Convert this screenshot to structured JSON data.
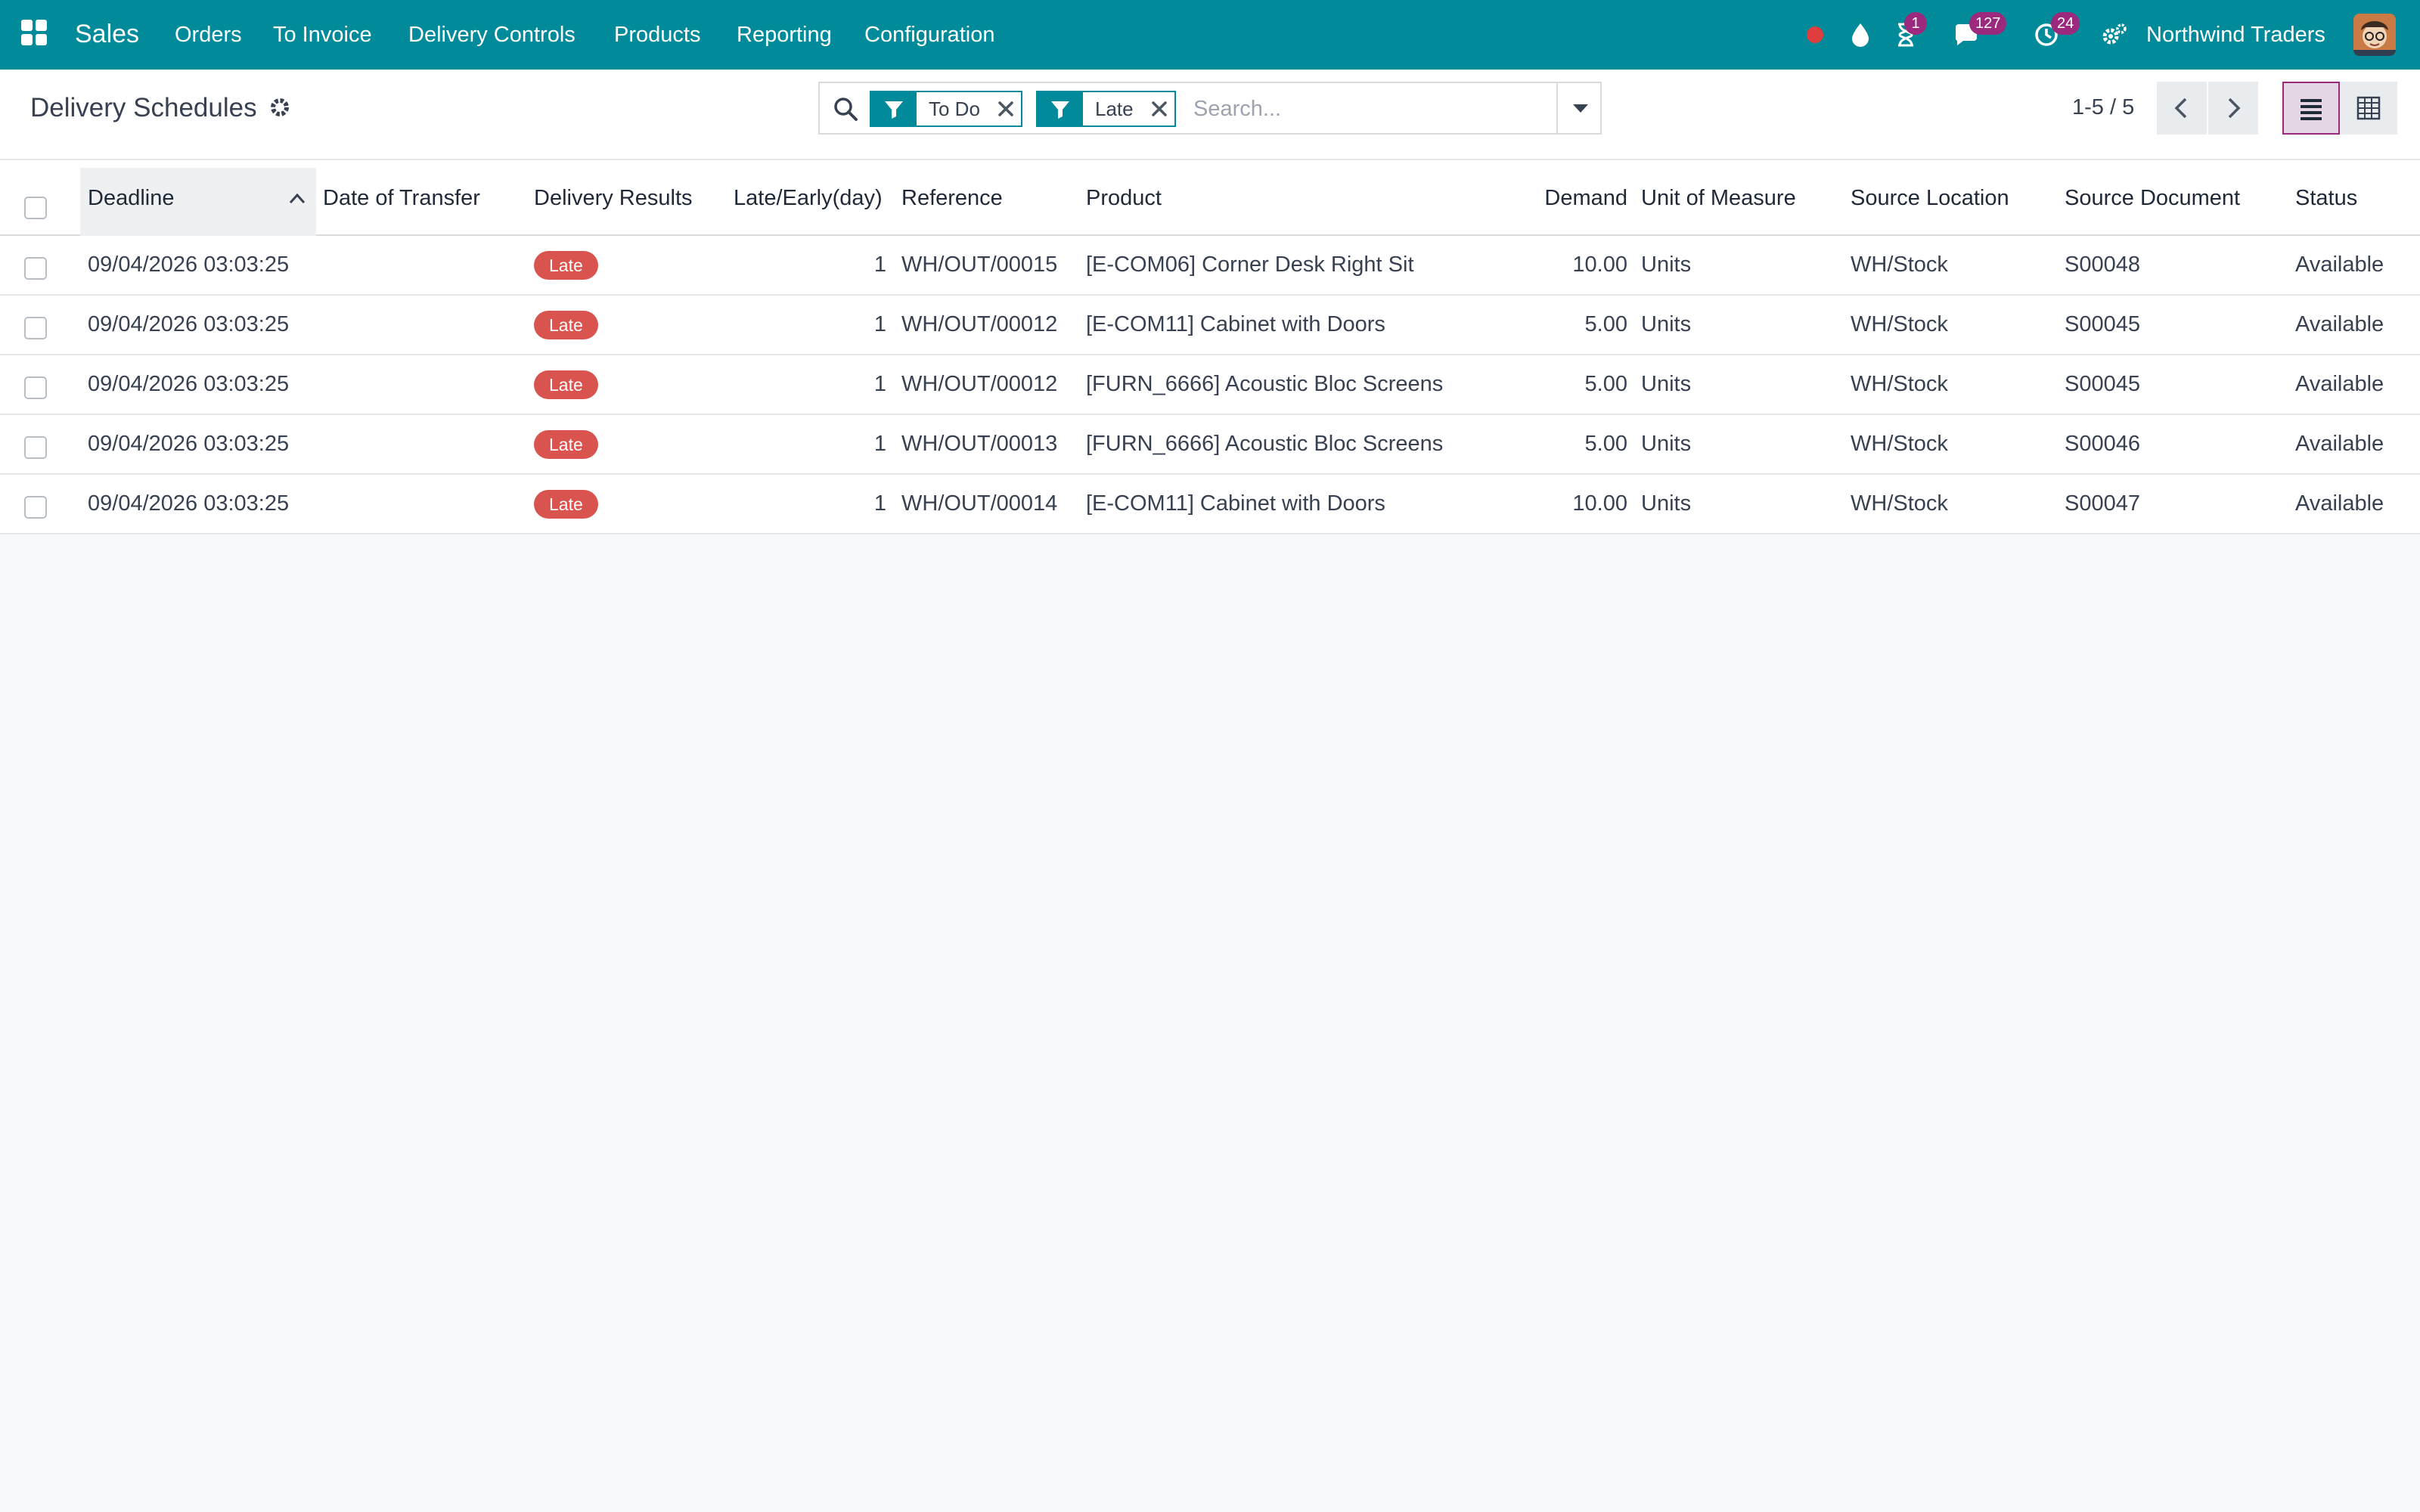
{
  "navbar": {
    "app_name": "Sales",
    "menu": [
      "Orders",
      "To Invoice",
      "Delivery Controls",
      "Products",
      "Reporting",
      "Configuration"
    ],
    "badges": {
      "activities": "1",
      "messages": "127",
      "timer": "24"
    },
    "company": "Northwind Traders",
    "icons": [
      "apps-grid-icon",
      "record-dot-icon",
      "droplet-icon",
      "hourglass-icon",
      "chat-icon",
      "clock-icon",
      "settings-cogs-icon"
    ]
  },
  "control_panel": {
    "title": "Delivery Schedules",
    "facets": [
      "To Do",
      "Late"
    ],
    "search_placeholder": "Search...",
    "pager": "1-5 / 5"
  },
  "table": {
    "columns": [
      "Deadline",
      "Date of Transfer",
      "Delivery Results",
      "Late/Early(day)",
      "Reference",
      "Product",
      "Demand",
      "Unit of Measure",
      "Source Location",
      "Source Document",
      "Status"
    ],
    "rows": [
      {
        "deadline": "09/04/2026 03:03:25",
        "transfer": "",
        "result": "Late",
        "late_days": "1",
        "reference": "WH/OUT/00015",
        "product": "[E-COM06] Corner Desk Right Sit",
        "demand": "10.00",
        "uom": "Units",
        "source_location": "WH/Stock",
        "source_document": "S00048",
        "status": "Available"
      },
      {
        "deadline": "09/04/2026 03:03:25",
        "transfer": "",
        "result": "Late",
        "late_days": "1",
        "reference": "WH/OUT/00012",
        "product": "[E-COM11] Cabinet with Doors",
        "demand": "5.00",
        "uom": "Units",
        "source_location": "WH/Stock",
        "source_document": "S00045",
        "status": "Available"
      },
      {
        "deadline": "09/04/2026 03:03:25",
        "transfer": "",
        "result": "Late",
        "late_days": "1",
        "reference": "WH/OUT/00012",
        "product": "[FURN_6666] Acoustic Bloc Screens",
        "demand": "5.00",
        "uom": "Units",
        "source_location": "WH/Stock",
        "source_document": "S00045",
        "status": "Available"
      },
      {
        "deadline": "09/04/2026 03:03:25",
        "transfer": "",
        "result": "Late",
        "late_days": "1",
        "reference": "WH/OUT/00013",
        "product": "[FURN_6666] Acoustic Bloc Screens",
        "demand": "5.00",
        "uom": "Units",
        "source_location": "WH/Stock",
        "source_document": "S00046",
        "status": "Available"
      },
      {
        "deadline": "09/04/2026 03:03:25",
        "transfer": "",
        "result": "Late",
        "late_days": "1",
        "reference": "WH/OUT/00014",
        "product": "[E-COM11] Cabinet with Doors",
        "demand": "10.00",
        "uom": "Units",
        "source_location": "WH/Stock",
        "source_document": "S00047",
        "status": "Available"
      }
    ]
  },
  "colors": {
    "brand": "#018a99",
    "badge": "#9b2a7e",
    "late_tag": "#d9534f",
    "record_dot": "#e03e3e",
    "active_view": "#9b2a7e"
  }
}
